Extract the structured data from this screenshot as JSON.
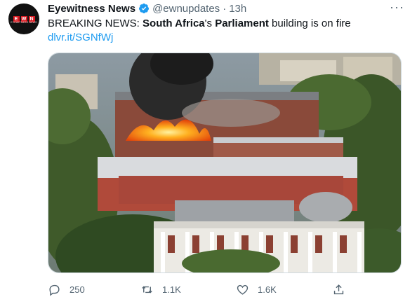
{
  "account": {
    "avatar_top": "E W N",
    "avatar_sub": "EYEWITNESS NEWS",
    "name": "Eyewitness News",
    "verified_icon": "verified-badge-icon",
    "handle": "@ewnupdates",
    "separator": "·",
    "time": "13h"
  },
  "more_label": "···",
  "tweet": {
    "part1": "BREAKING NEWS: ",
    "bold1": "South Africa",
    "part2": "'s ",
    "bold2": "Parliament",
    "part3": " building is on fire",
    "link": "dlvr.it/SGNfWj"
  },
  "media": {
    "description_icon": "parliament-fire-photo"
  },
  "actions": {
    "reply": {
      "icon": "reply-icon",
      "count": "250"
    },
    "retweet": {
      "icon": "retweet-icon",
      "count": "1.1K"
    },
    "like": {
      "icon": "like-icon",
      "count": "1.6K"
    },
    "share": {
      "icon": "share-icon"
    }
  },
  "colors": {
    "accent": "#1d9bf0",
    "muted": "#536471",
    "text": "#0f1419",
    "brand_red": "#d71920"
  }
}
